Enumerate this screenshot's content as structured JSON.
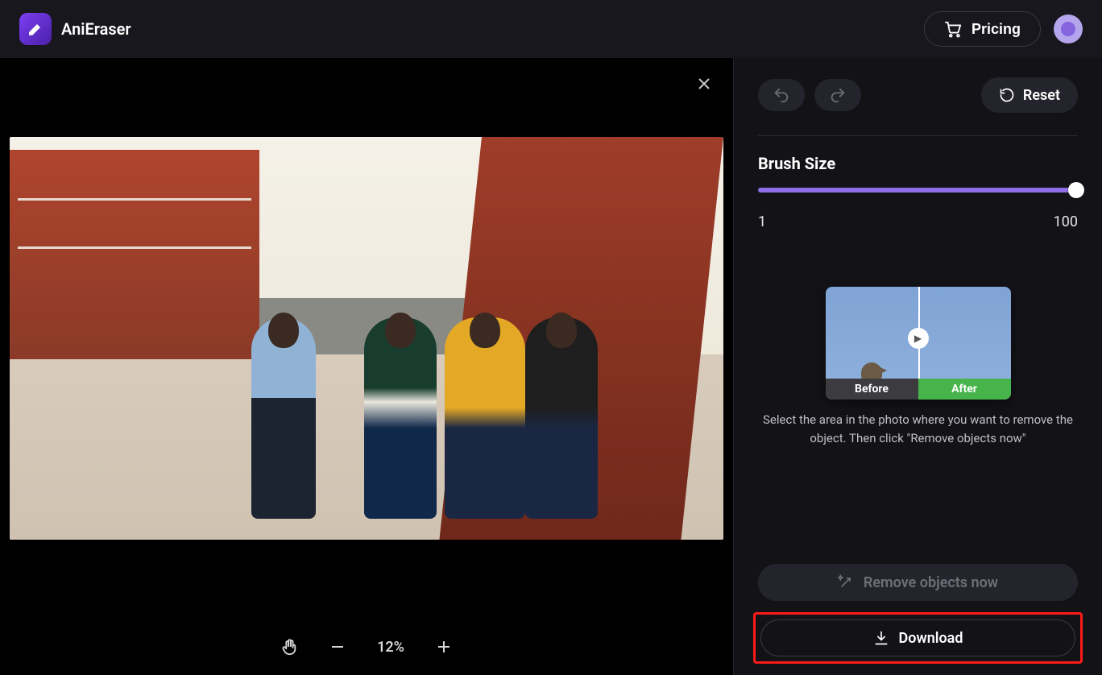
{
  "header": {
    "brand": "AniEraser",
    "pricing_label": "Pricing"
  },
  "canvas": {
    "zoom_level": "12%"
  },
  "sidebar": {
    "reset_label": "Reset",
    "brush_label": "Brush Size",
    "brush_min": "1",
    "brush_max": "100",
    "brush_value": 100,
    "preview": {
      "before_label": "Before",
      "after_label": "After"
    },
    "hint": "Select the area in the photo where you want to remove the object. Then click \"Remove objects now\"",
    "remove_label": "Remove objects now",
    "download_label": "Download"
  },
  "colors": {
    "accent": "#8f6fe8",
    "success": "#46b44a",
    "highlight": "#ff1a1a"
  }
}
